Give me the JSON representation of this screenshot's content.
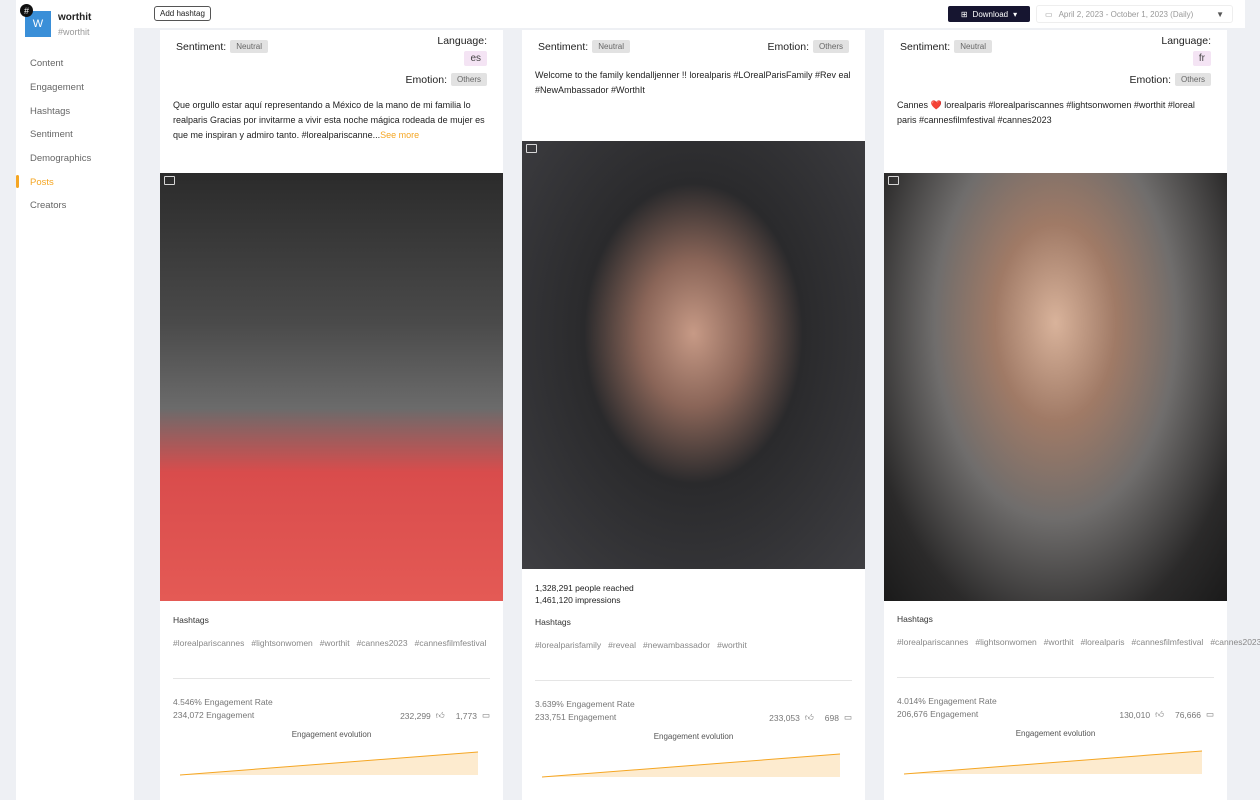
{
  "sidebar": {
    "logo_letter": "W",
    "badge": "#",
    "brand": "worthit",
    "handle": "#worthit",
    "items": [
      {
        "label": "Content"
      },
      {
        "label": "Engagement"
      },
      {
        "label": "Hashtags"
      },
      {
        "label": "Sentiment"
      },
      {
        "label": "Demographics"
      },
      {
        "label": "Posts",
        "active": true
      },
      {
        "label": "Creators"
      }
    ]
  },
  "topbar": {
    "add_hashtag": "Add hashtag",
    "download": "Download",
    "date_range": "April 2, 2023 - October 1, 2023 (Daily)"
  },
  "labels": {
    "sentiment": "Sentiment:",
    "language": "Language:",
    "emotion": "Emotion:",
    "hashtags": "Hashtags",
    "evolution": "Engagement evolution",
    "see_more": "See more"
  },
  "accent": "#f5a623",
  "posts": [
    {
      "sentiment": "Neutral",
      "language": "es",
      "emotion": "Others",
      "caption": "Que orgullo estar aquí representando a México de la mano de mi familia lo realparis Gracias por invitarme a vivir esta noche mágica rodeada de mujer es que me inspiran y admiro tanto. #lorealpariscanne...",
      "truncated": true,
      "hashtags": [
        "#lorealpariscannes",
        "#lightsonwomen",
        "#worthit",
        "#cannes2023",
        "#cannesfilmfestival"
      ],
      "engagement_rate": "4.546% Engagement Rate",
      "engagement": "234,072 Engagement",
      "likes": "232,299",
      "comments": "1,773"
    },
    {
      "sentiment": "Neutral",
      "emotion": "Others",
      "caption": "Welcome to the family kendalljenner !! lorealparis #LOrealParisFamily #Rev eal #NewAmbassador #WorthIt",
      "reach": "1,328,291 people reached",
      "impressions": "1,461,120 impressions",
      "hashtags": [
        "#lorealparisfamily",
        "#reveal",
        "#newambassador",
        "#worthit"
      ],
      "engagement_rate": "3.639% Engagement Rate",
      "engagement": "233,751 Engagement",
      "likes": "233,053",
      "comments": "698"
    },
    {
      "sentiment": "Neutral",
      "language": "fr",
      "emotion": "Others",
      "caption": "Cannes ❤️ lorealparis #lorealpariscannes #lightsonwomen #worthit #loreal paris #cannesfilmfestival #cannes2023",
      "hashtags": [
        "#lorealpariscannes",
        "#lightsonwomen",
        "#worthit",
        "#lorealparis",
        "#cannesfilmfestival",
        "#cannes2023"
      ],
      "engagement_rate": "4.014% Engagement Rate",
      "engagement": "206,676 Engagement",
      "likes": "130,010",
      "comments": "76,666"
    }
  ]
}
